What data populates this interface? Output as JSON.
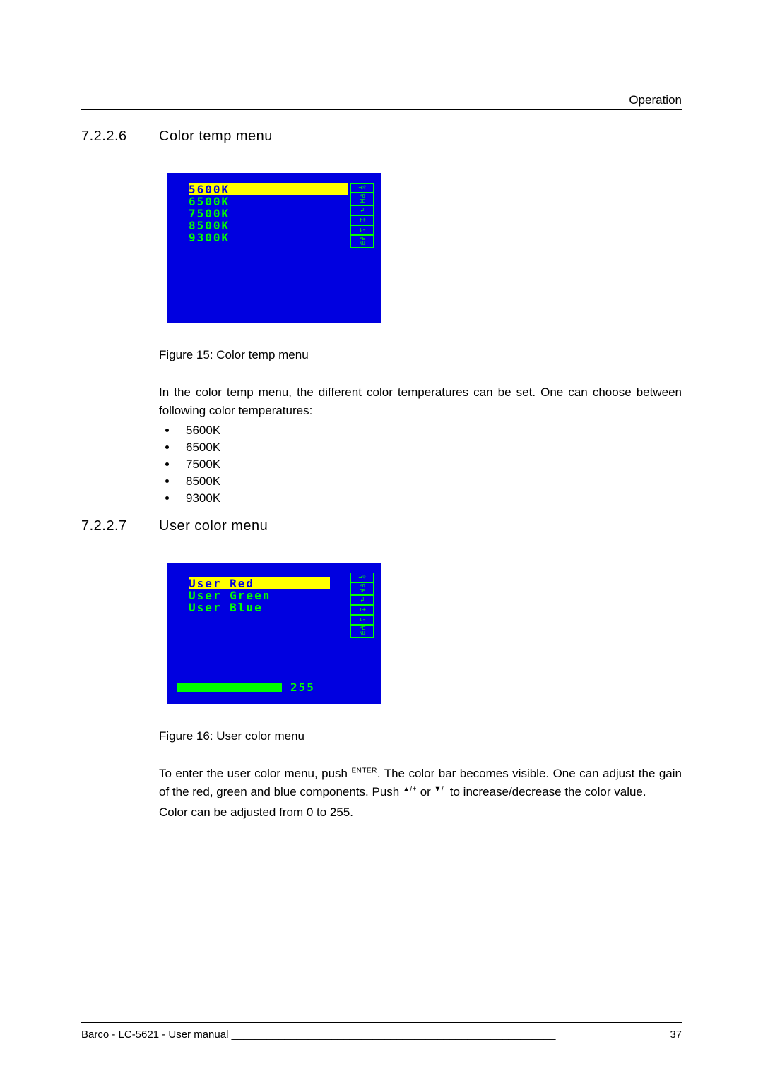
{
  "header": {
    "section_label": "Operation"
  },
  "sec1": {
    "num": "7.2.2.6",
    "title": "Color temp menu",
    "figcap": "Figure 15: Color temp menu",
    "para1": "In the color temp menu, the different color temperatures can be set.  One can choose between following color temperatures:",
    "items": [
      "5600K",
      "6500K",
      "7500K",
      "8500K",
      "9300K"
    ]
  },
  "sec2": {
    "num": "7.2.2.7",
    "title": "User color menu",
    "figcap": "Figure 16: User color menu",
    "para_a1": "To enter the user color menu, push ",
    "btn_enter": "ENTER",
    "para_a2": ". The color bar becomes visible.  One can adjust the gain of the red, green and blue components. Push ",
    "btn_up": "▲/+",
    "para_a3": " or ",
    "btn_down": "▼/-",
    "para_a4": " to increase/decrease the color value.",
    "para_b": "Color can be adjusted from 0 to 255."
  },
  "osd1": {
    "items": [
      "5600K",
      "6500K",
      "7500K",
      "8500K",
      "9300K"
    ],
    "selected": 0,
    "buttons": [
      "→☼",
      "MO\nDE",
      "↲",
      "↑+",
      "↓-",
      "ME\nNU"
    ]
  },
  "osd2": {
    "items": [
      "User Red",
      "User Green",
      "User Blue"
    ],
    "selected": 0,
    "value": "255",
    "buttons": [
      "→☼",
      "MO\nDE",
      "↲",
      "↑+",
      "↓-",
      "ME\nNU"
    ]
  },
  "footer": {
    "left": "Barco - LC-5621 - User manual ",
    "dash": "_______________________________________________________",
    "page": "37"
  }
}
